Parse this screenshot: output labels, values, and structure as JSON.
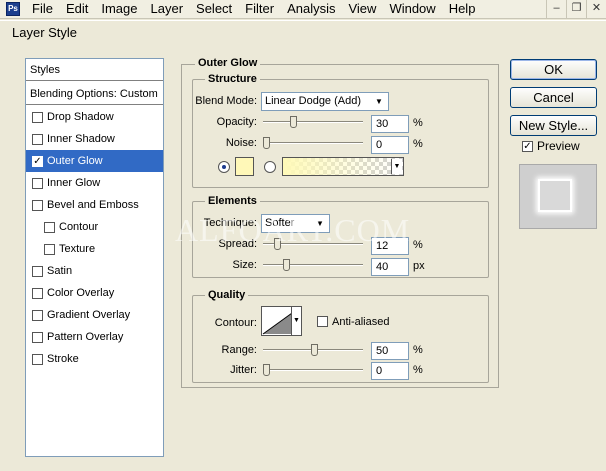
{
  "menubar": {
    "app_icon": "Ps",
    "items": [
      "File",
      "Edit",
      "Image",
      "Layer",
      "Select",
      "Filter",
      "Analysis",
      "View",
      "Window",
      "Help"
    ],
    "controls": [
      "minimize-icon",
      "restore-icon",
      "close-icon"
    ]
  },
  "dialog": {
    "title": "Layer Style"
  },
  "styles_list": {
    "header": "Styles",
    "blending": "Blending Options: Custom",
    "items": [
      {
        "label": "Drop Shadow",
        "checked": false
      },
      {
        "label": "Inner Shadow",
        "checked": false
      },
      {
        "label": "Outer Glow",
        "checked": true,
        "selected": true
      },
      {
        "label": "Inner Glow",
        "checked": false
      },
      {
        "label": "Bevel and Emboss",
        "checked": false
      },
      {
        "label": "Contour",
        "checked": false
      },
      {
        "label": "Texture",
        "checked": false
      },
      {
        "label": "Satin",
        "checked": false
      },
      {
        "label": "Color Overlay",
        "checked": false
      },
      {
        "label": "Gradient Overlay",
        "checked": false
      },
      {
        "label": "Pattern Overlay",
        "checked": false
      },
      {
        "label": "Stroke",
        "checked": false
      }
    ]
  },
  "outer_glow": {
    "title": "Outer Glow",
    "structure": {
      "title": "Structure",
      "blend_mode_label": "Blend Mode:",
      "blend_mode_value": "Linear Dodge (Add)",
      "opacity_label": "Opacity:",
      "opacity_value": "30",
      "opacity_unit": "%",
      "noise_label": "Noise:",
      "noise_value": "0",
      "noise_unit": "%",
      "color_mode": "solid",
      "glow_color": "#fff8b8"
    },
    "elements": {
      "title": "Elements",
      "technique_label": "Technique:",
      "technique_value": "Softer",
      "spread_label": "Spread:",
      "spread_value": "12",
      "spread_unit": "%",
      "size_label": "Size:",
      "size_value": "40",
      "size_unit": "px"
    },
    "quality": {
      "title": "Quality",
      "contour_label": "Contour:",
      "anti_aliased_label": "Anti-aliased",
      "anti_aliased": false,
      "range_label": "Range:",
      "range_value": "50",
      "range_unit": "%",
      "jitter_label": "Jitter:",
      "jitter_value": "0",
      "jitter_unit": "%"
    }
  },
  "buttons": {
    "ok": "OK",
    "cancel": "Cancel",
    "new_style": "New Style...",
    "preview_label": "Preview",
    "preview_checked": true
  },
  "watermark": "ALFOART.COM"
}
